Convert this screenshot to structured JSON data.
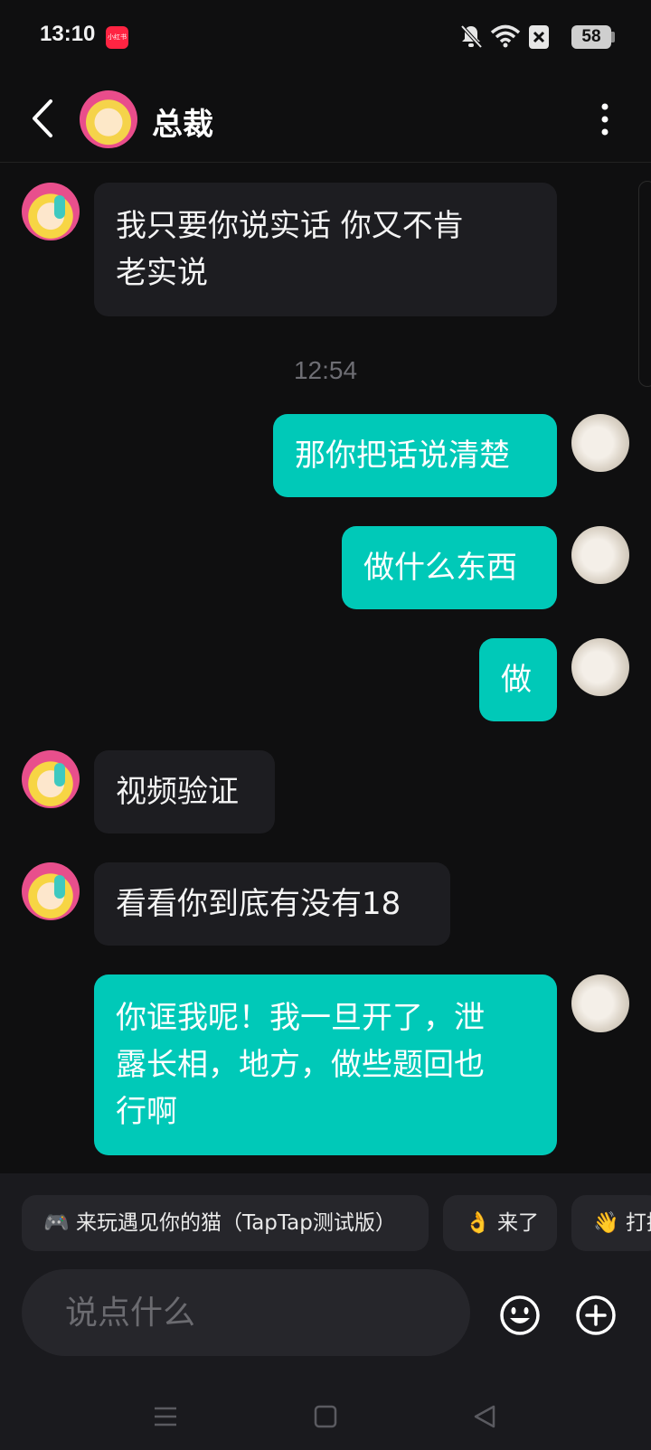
{
  "status_bar": {
    "time": "13:10",
    "app_badge": "小红书",
    "battery": "58",
    "icons": [
      "bell-off-icon",
      "wifi-icon",
      "close-box-icon",
      "battery-icon"
    ]
  },
  "header": {
    "contact_name": "总裁",
    "icons": [
      "back-icon",
      "more-vertical-icon"
    ]
  },
  "messages": [
    {
      "side": "in",
      "text": "我只要你说实话 你又不肯\n老实说"
    },
    {
      "type": "timestamp",
      "text": "12:54"
    },
    {
      "side": "out",
      "text": "那你把话说清楚"
    },
    {
      "side": "out",
      "text": "做什么东西"
    },
    {
      "side": "out",
      "text": "做"
    },
    {
      "side": "in",
      "text": "视频验证"
    },
    {
      "side": "in",
      "text": "看看你到底有没有18"
    },
    {
      "side": "out",
      "text": "你诓我呢！我一旦开了，泄\n露长相，地方，做些题回也\n行啊"
    }
  ],
  "quick_replies": [
    {
      "icon": "🎮",
      "label": "来玩遇见你的猫（TapTap测试版）"
    },
    {
      "icon": "👌",
      "label": "来了"
    },
    {
      "icon": "👋",
      "label": "打招呼"
    }
  ],
  "composer": {
    "placeholder": "说点什么",
    "icons": [
      "emoji-icon",
      "plus-circle-icon"
    ]
  },
  "nav": {
    "icons": [
      "menu-icon",
      "home-square-icon",
      "back-triangle-icon"
    ]
  },
  "colors": {
    "background": "#0f0f10",
    "incoming_bubble": "#1d1d21",
    "outgoing_bubble": "#00c9b8",
    "panel": "#1a1a1e"
  }
}
